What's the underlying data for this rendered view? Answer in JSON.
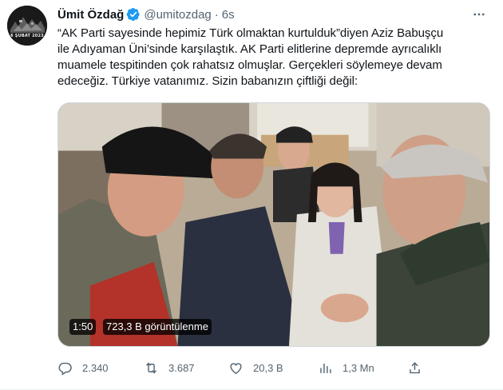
{
  "avatar": {
    "caption": "6 ŞUBAT 2023"
  },
  "author": {
    "name": "Ümit Özdağ",
    "handle": "@umitozdag",
    "separator": "·",
    "time": "6s"
  },
  "tweet": {
    "text": "“AK Parti sayesinde hepimiz Türk olmaktan kurtulduk”diyen Aziz Babuşçu\nile Adıyaman Üni’sinde karşılaştık. AK Parti elitlerine depremde ayrıcalıklı\nmuamele tespitinden çok rahatsız olmuşlar. Gerçekleri söylemeye devam\nedeceğiz. Türkiye vatanımız. Sizin babanızın çiftliği değil:"
  },
  "video": {
    "duration": "1:50",
    "views": "723,3 B görüntülenme"
  },
  "actions": {
    "replies": "2.340",
    "retweets": "3.687",
    "likes": "20,3 B",
    "views": "1,3 Mn"
  },
  "colors": {
    "text": "#0f1419",
    "secondary": "#536471",
    "verified": "#1d9bf0",
    "border": "#cfd9de"
  },
  "icons": [
    "verified-badge-icon",
    "more-icon",
    "reply-icon",
    "retweet-icon",
    "like-icon",
    "views-icon",
    "share-icon"
  ]
}
